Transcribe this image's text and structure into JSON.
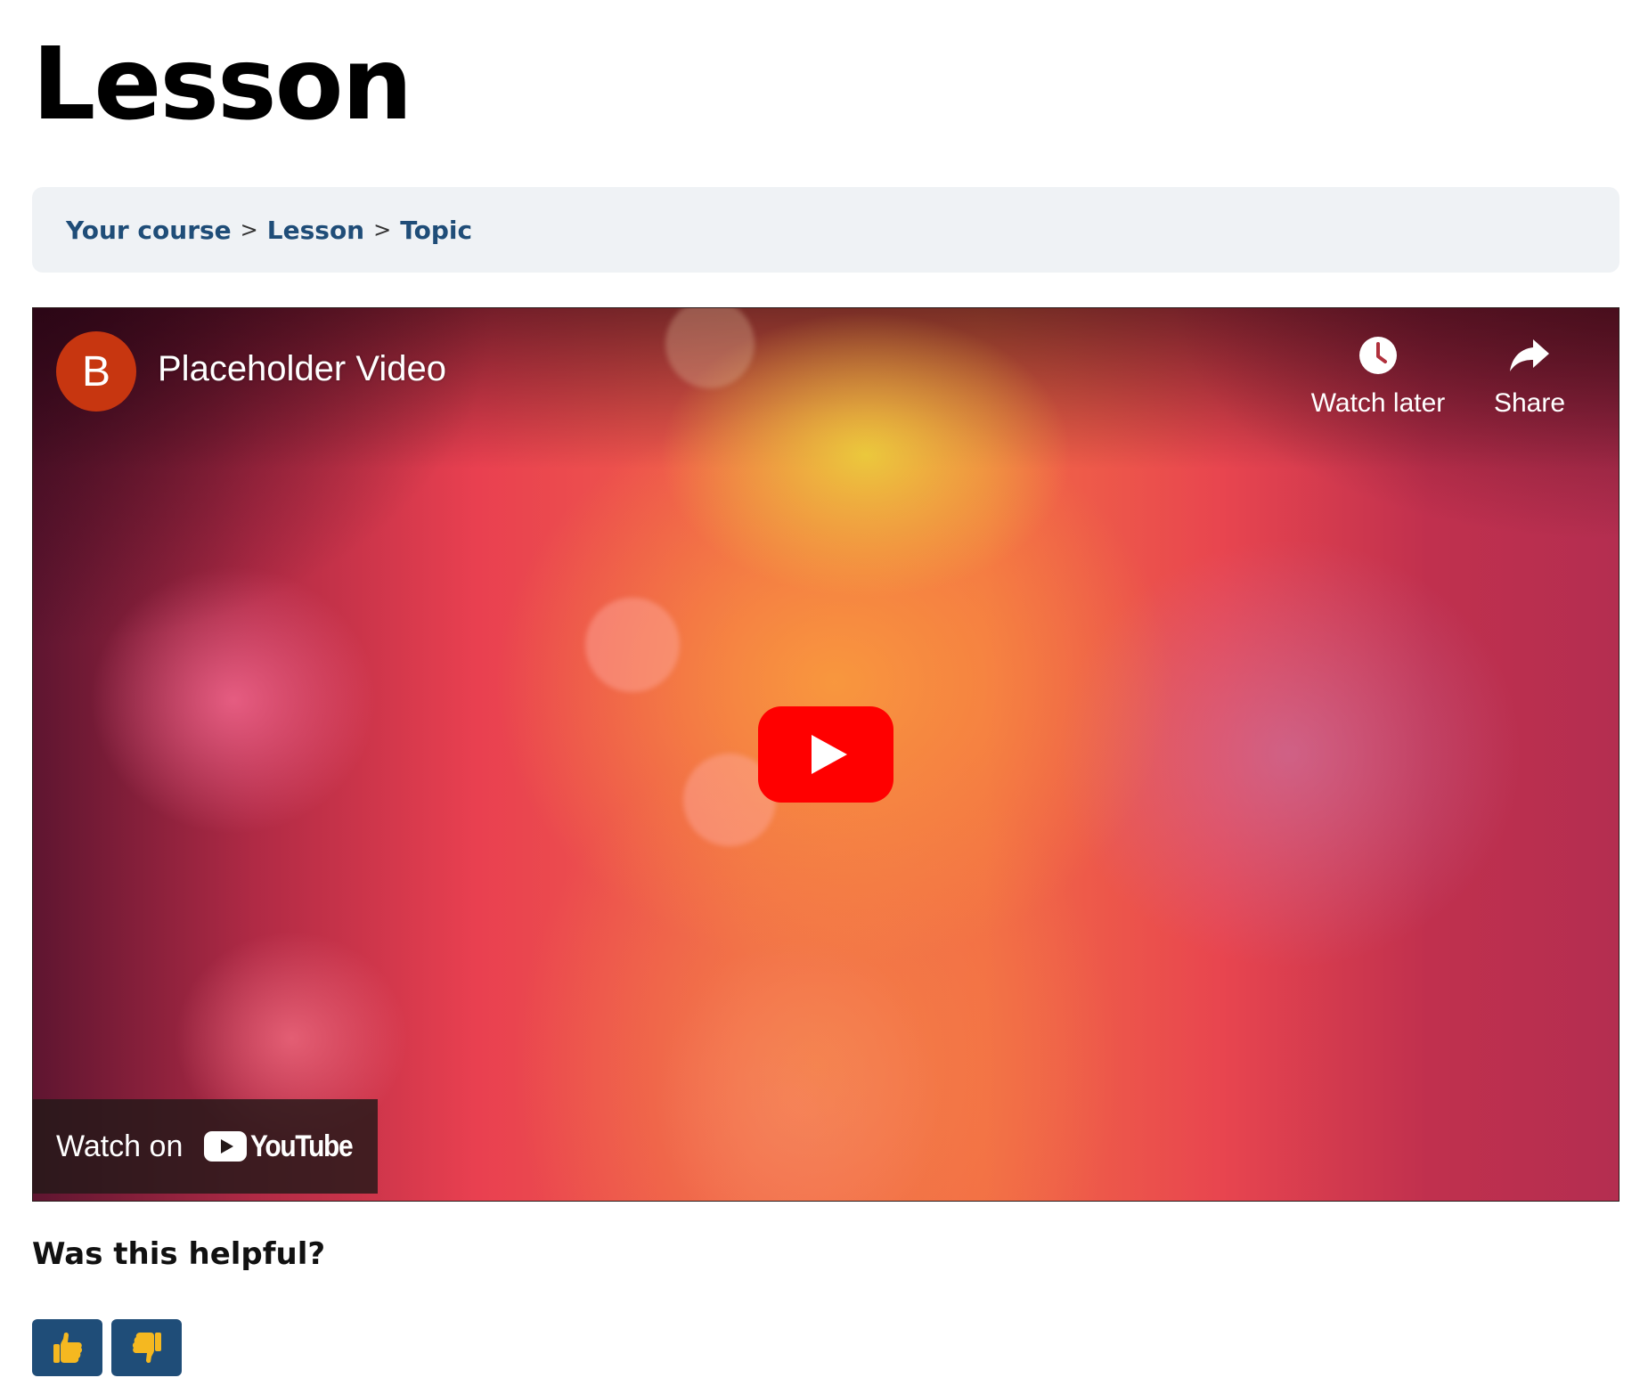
{
  "page": {
    "title": "Lesson"
  },
  "breadcrumb": {
    "items": [
      {
        "label": "Your course"
      },
      {
        "label": "Lesson"
      },
      {
        "label": "Topic"
      }
    ],
    "separator": ">"
  },
  "video": {
    "channel_initial": "B",
    "channel_avatar_color": "#c73610",
    "title": "Placeholder Video",
    "watch_later_label": "Watch later",
    "share_label": "Share",
    "play_icon": "youtube-play-icon",
    "watch_on_label": "Watch on",
    "youtube_logo_text": "YouTube",
    "play_button_color": "#ff0000"
  },
  "feedback": {
    "question": "Was this helpful?",
    "thumbs_up_icon": "thumbs-up-icon",
    "thumbs_down_icon": "thumbs-down-icon",
    "button_color": "#1f4d78",
    "icon_color": "#f5b820"
  },
  "colors": {
    "link": "#1f4d78",
    "breadcrumb_bg": "#eff2f5"
  }
}
